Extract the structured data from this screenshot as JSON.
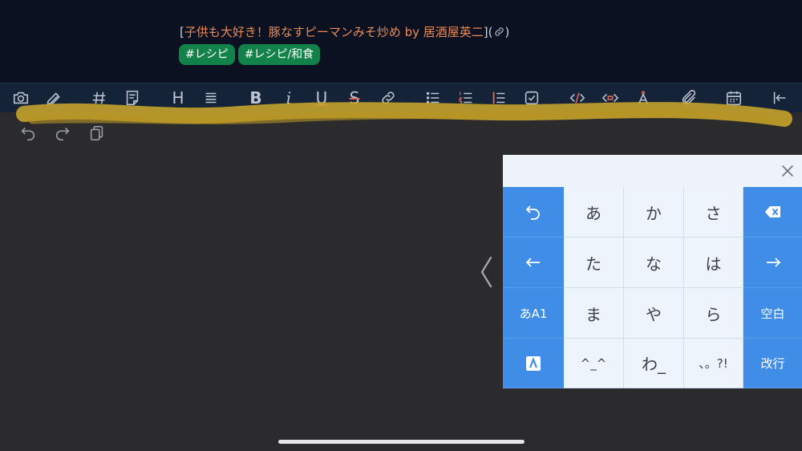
{
  "note": {
    "link": {
      "open_bracket": "[",
      "title": "子供も大好き！豚なすピーマンみそ炒め by 居酒屋英二",
      "close_bracket": "](",
      "icon": "link-icon",
      "end_paren": ")"
    },
    "tags": [
      "#レシピ",
      "#レシピ/和食"
    ]
  },
  "toolbar": {
    "items": [
      {
        "name": "camera",
        "icon": "camera-icon"
      },
      {
        "name": "draw",
        "icon": "pencil-ruler-icon"
      },
      {
        "name": "tag",
        "icon": "hash-icon"
      },
      {
        "name": "note",
        "icon": "note-icon"
      },
      {
        "name": "heading",
        "label": "H"
      },
      {
        "name": "align",
        "icon": "align-icon"
      },
      {
        "name": "bold",
        "label": "B"
      },
      {
        "name": "italic",
        "label": "i"
      },
      {
        "name": "underline",
        "label": "U"
      },
      {
        "name": "strikethrough",
        "label": "S"
      },
      {
        "name": "link",
        "icon": "link-icon"
      },
      {
        "name": "bullet-list",
        "icon": "bullet-list-icon"
      },
      {
        "name": "numbered-list",
        "icon": "numbered-list-icon"
      },
      {
        "name": "quote",
        "icon": "quote-icon"
      },
      {
        "name": "checkbox",
        "icon": "checkbox-icon"
      },
      {
        "name": "code",
        "icon": "code-icon"
      },
      {
        "name": "code-block",
        "icon": "code-block-icon"
      },
      {
        "name": "compass",
        "icon": "compass-icon"
      },
      {
        "name": "attachment",
        "icon": "paperclip-icon"
      },
      {
        "name": "calendar",
        "icon": "calendar-icon"
      },
      {
        "name": "collapse",
        "icon": "collapse-left-icon"
      }
    ]
  },
  "edit_controls": {
    "undo": "undo-icon",
    "redo": "redo-icon",
    "copy": "copy-icon"
  },
  "keyboard": {
    "rows": [
      [
        "undo-icon",
        "あ",
        "か",
        "さ",
        "delete-icon"
      ],
      [
        "left-arrow-icon",
        "た",
        "な",
        "は",
        "right-arrow-icon"
      ],
      [
        "あA1",
        "ま",
        "や",
        "ら",
        "空白"
      ],
      [
        "logo-icon",
        "^_^",
        "わ_",
        "、。?!",
        "改行"
      ]
    ]
  },
  "colors": {
    "accent_blue": "#3f8de6",
    "tag_green": "#12824a",
    "title_orange": "#e98b57",
    "highlight": "#c8a52a"
  }
}
